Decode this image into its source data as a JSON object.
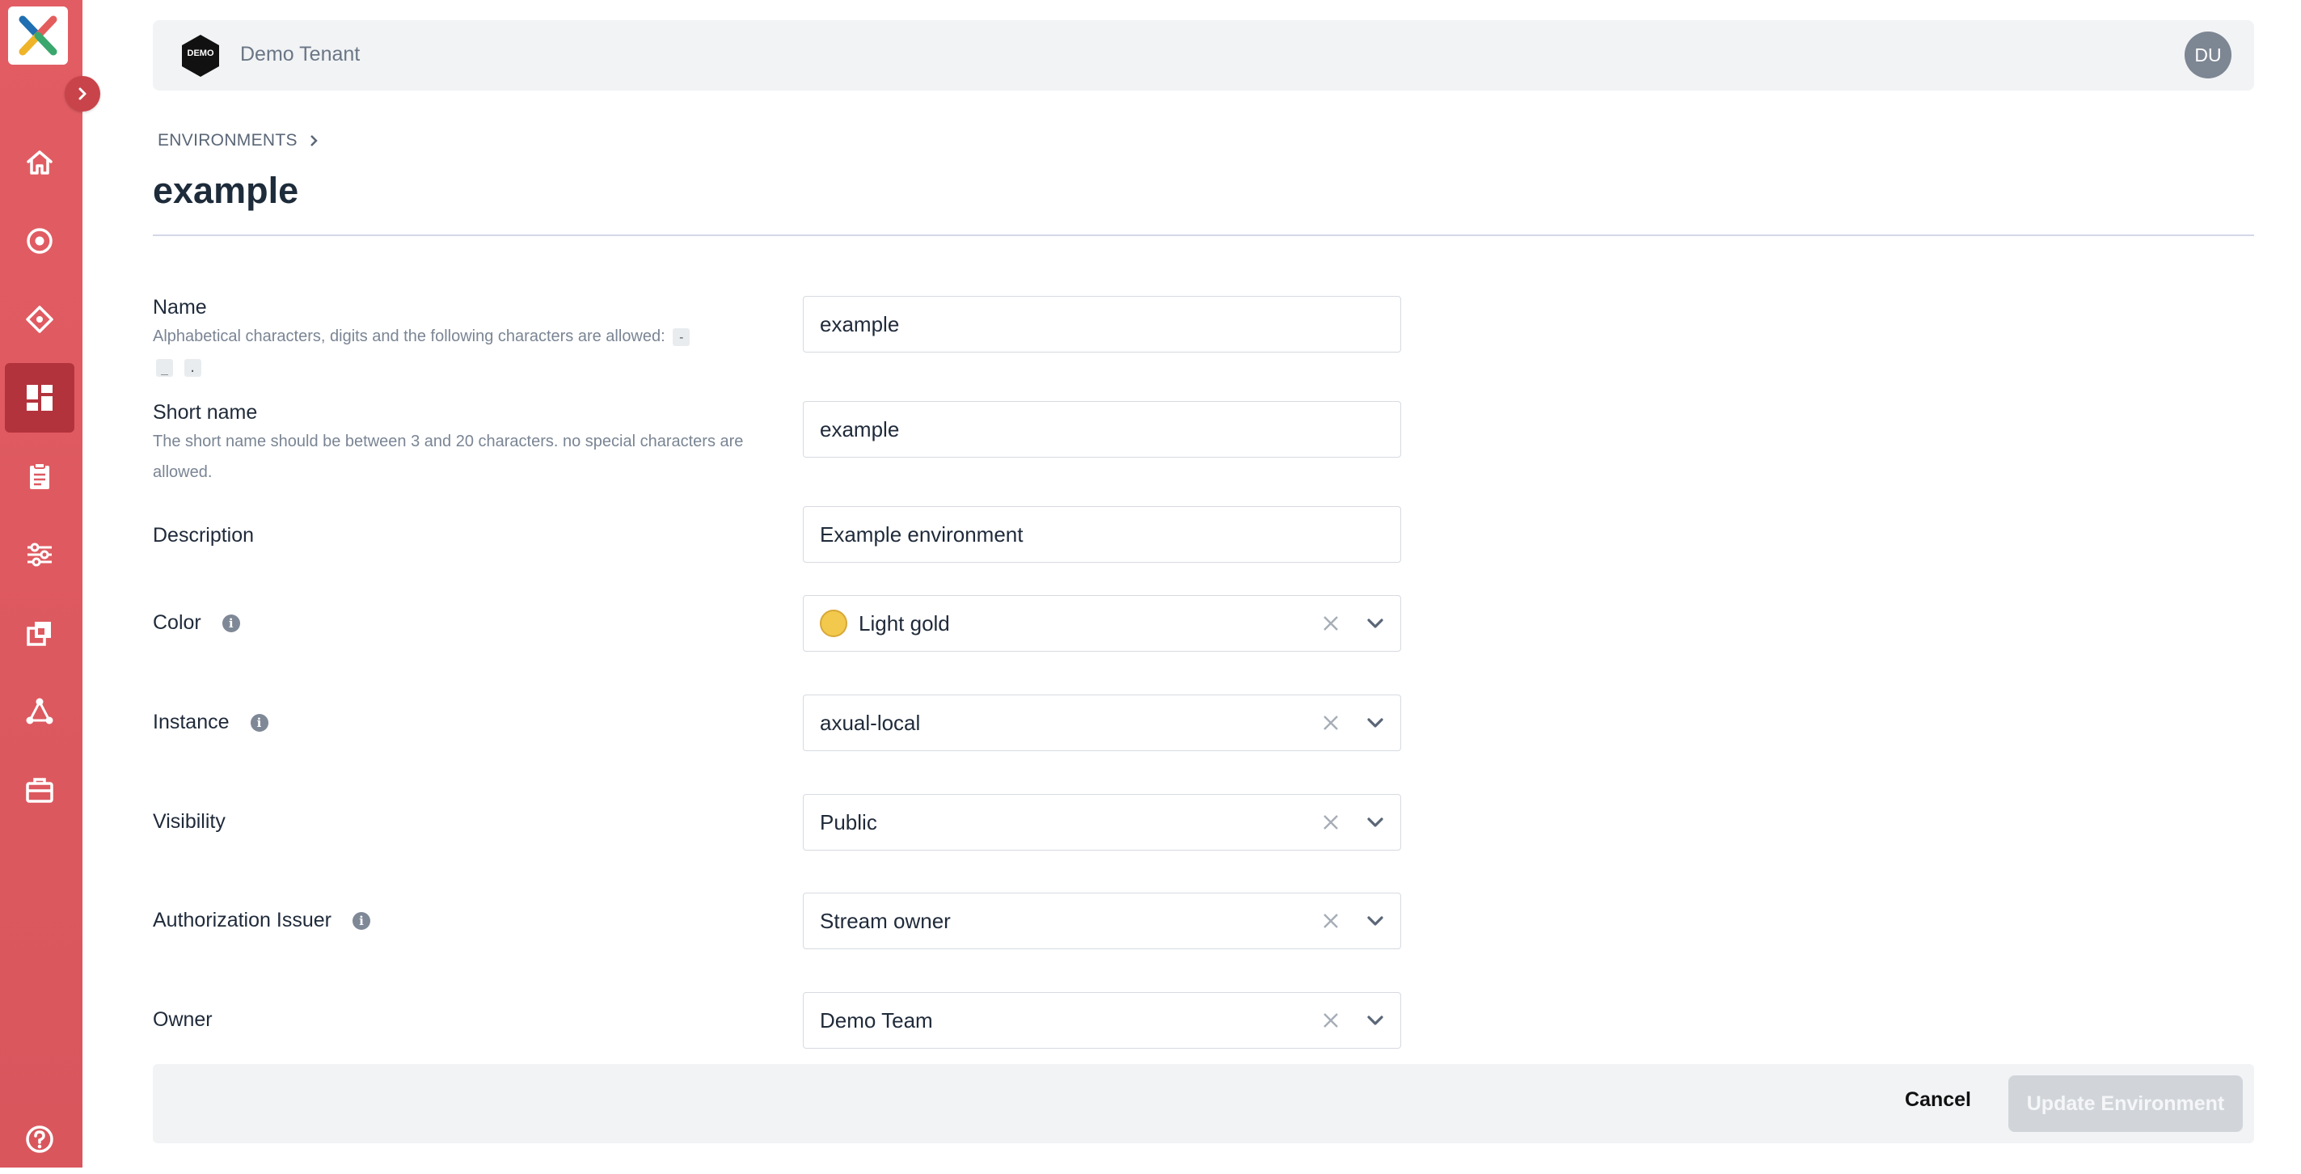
{
  "header": {
    "tenant_logo_text": "DEMO",
    "tenant_name": "Demo Tenant",
    "avatar_initials": "DU"
  },
  "sidebar": {
    "items": [
      {
        "icon": "home-icon"
      },
      {
        "icon": "target-icon"
      },
      {
        "icon": "diamond-icon"
      },
      {
        "icon": "dashboard-grid-icon",
        "active": true
      },
      {
        "icon": "clipboard-icon"
      },
      {
        "icon": "sliders-icon"
      },
      {
        "icon": "copy-icon"
      },
      {
        "icon": "network-icon"
      },
      {
        "icon": "toolbox-icon"
      }
    ],
    "help_icon": "help-circle-icon"
  },
  "breadcrumb": {
    "item": "ENVIRONMENTS"
  },
  "page": {
    "title": "example"
  },
  "form": {
    "name": {
      "label": "Name",
      "help": "Alphabetical characters, digits and the following characters are allowed:",
      "allowed_chars": [
        "-",
        "_",
        "."
      ],
      "value": "example"
    },
    "short_name": {
      "label": "Short name",
      "help": "The short name should be between 3 and 20 characters. no special characters are allowed.",
      "value": "example"
    },
    "description": {
      "label": "Description",
      "value": "Example environment"
    },
    "color": {
      "label": "Color",
      "value": "Light gold",
      "swatch": "#f2c94c"
    },
    "instance": {
      "label": "Instance",
      "value": "axual-local"
    },
    "visibility": {
      "label": "Visibility",
      "value": "Public"
    },
    "authorization_issuer": {
      "label": "Authorization Issuer",
      "value": "Stream owner"
    },
    "owner": {
      "label": "Owner",
      "value": "Demo Team"
    }
  },
  "footer": {
    "cancel_label": "Cancel",
    "submit_label": "Update Environment"
  },
  "colors": {
    "sidebar": "#dd5a60",
    "sidebar_active": "#b3333c",
    "submit_disabled": "#d1d5da"
  }
}
